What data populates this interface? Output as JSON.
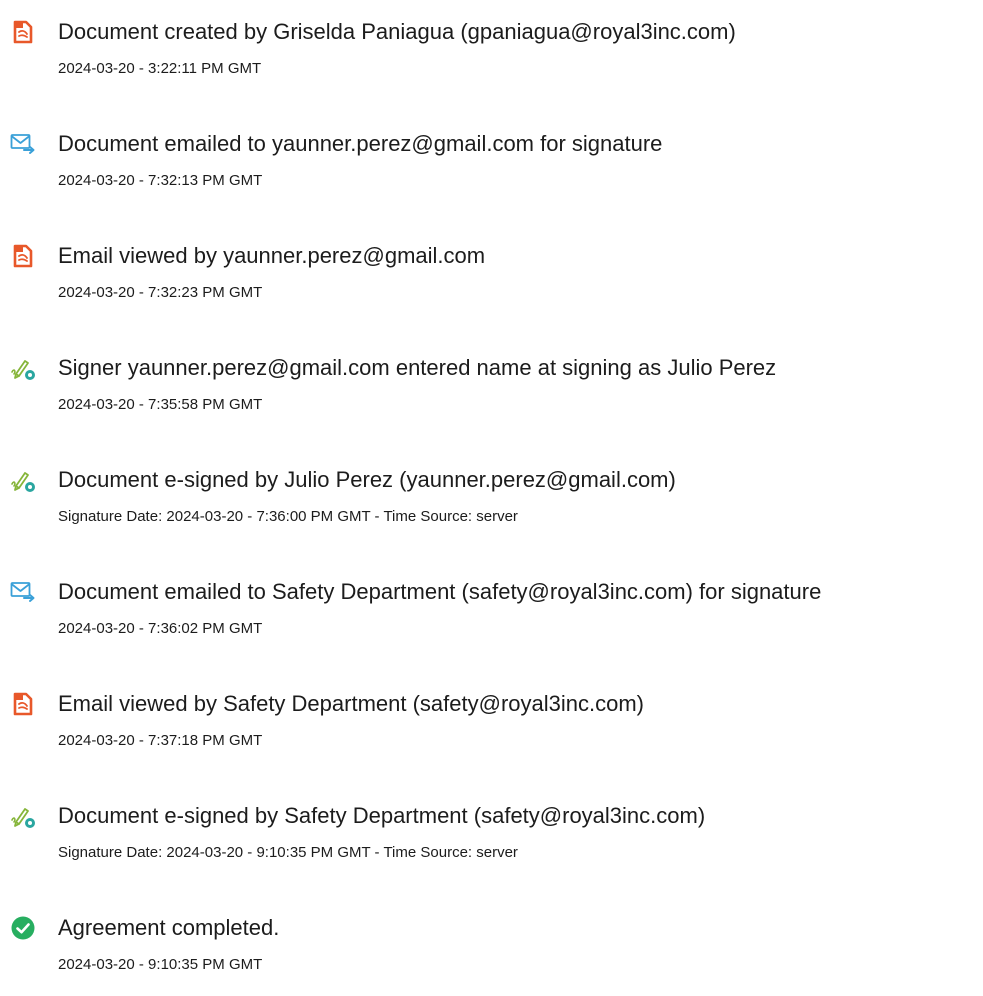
{
  "entries": [
    {
      "icon": "document-icon",
      "title": "Document created by Griselda Paniagua (gpaniagua@royal3inc.com)",
      "sub": "2024-03-20 - 3:22:11 PM GMT"
    },
    {
      "icon": "email-icon",
      "title": "Document emailed to yaunner.perez@gmail.com for signature",
      "sub": "2024-03-20 - 7:32:13 PM GMT"
    },
    {
      "icon": "document-icon",
      "title": "Email viewed by yaunner.perez@gmail.com",
      "sub": "2024-03-20 - 7:32:23 PM GMT"
    },
    {
      "icon": "e-sign-icon",
      "title": "Signer yaunner.perez@gmail.com entered name at signing as Julio Perez",
      "sub": "2024-03-20 - 7:35:58 PM GMT"
    },
    {
      "icon": "e-sign-icon",
      "title": "Document e-signed by Julio Perez (yaunner.perez@gmail.com)",
      "sub": "Signature Date: 2024-03-20 - 7:36:00 PM GMT - Time Source: server"
    },
    {
      "icon": "email-icon",
      "title": "Document emailed to Safety Department (safety@royal3inc.com) for signature",
      "sub": "2024-03-20 - 7:36:02 PM GMT"
    },
    {
      "icon": "document-icon",
      "title": "Email viewed by Safety Department (safety@royal3inc.com)",
      "sub": "2024-03-20 - 7:37:18 PM GMT"
    },
    {
      "icon": "e-sign-icon",
      "title": "Document e-signed by Safety Department (safety@royal3inc.com)",
      "sub": "Signature Date: 2024-03-20 - 9:10:35 PM GMT - Time Source: server"
    },
    {
      "icon": "check-circle-icon",
      "title": "Agreement completed.",
      "sub": "2024-03-20 - 9:10:35 PM GMT"
    }
  ],
  "colors": {
    "document_icon": "#e8582a",
    "email_icon": "#3aa0d8",
    "esign_icon": "#86b53a",
    "esign_badge": "#2aa6a0",
    "check_icon": "#27ae60"
  }
}
